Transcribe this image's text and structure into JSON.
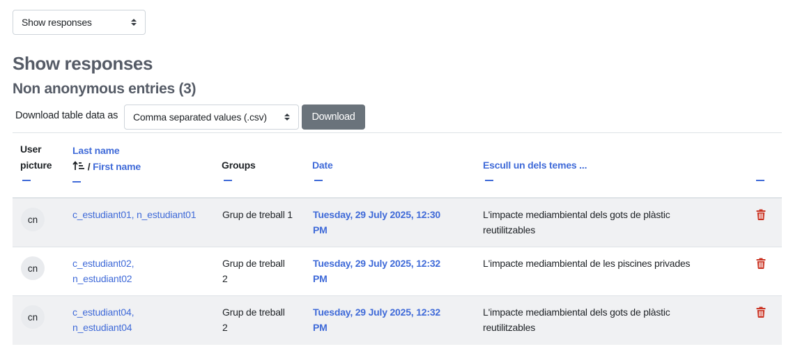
{
  "view_select": {
    "value": "Show responses"
  },
  "page_title": "Show responses",
  "section_title": "Non anonymous entries (3)",
  "download": {
    "label": "Download table data as",
    "format_value": "Comma separated values (.csv)",
    "button_label": "Download"
  },
  "table": {
    "headers": {
      "user_picture_line1": "User",
      "user_picture_line2": "picture",
      "last_name": "Last name",
      "separator": "/",
      "first_name": "First name",
      "groups": "Groups",
      "date": "Date",
      "question": "Escull un dels temes ..."
    },
    "rows": [
      {
        "initials": "cn",
        "name_line1": "c_estudiant01, n_estudiant01",
        "name_line2": "",
        "group_line1": "Grup de treball 1",
        "group_line2": "",
        "date_line1": "Tuesday, 29 July 2025, 12:30",
        "date_line2": "PM",
        "answer_line1": "L'impacte mediambiental dels gots de plàstic",
        "answer_line2": "reutilitzables"
      },
      {
        "initials": "cn",
        "name_line1": "c_estudiant02,",
        "name_line2": "n_estudiant02",
        "group_line1": "Grup de treball",
        "group_line2": "2",
        "date_line1": "Tuesday, 29 July 2025, 12:32",
        "date_line2": "PM",
        "answer_line1": "L'impacte mediambiental de les piscines privades",
        "answer_line2": ""
      },
      {
        "initials": "cn",
        "name_line1": "c_estudiant04,",
        "name_line2": "n_estudiant04",
        "group_line1": "Grup de treball",
        "group_line2": "2",
        "date_line1": "Tuesday, 29 July 2025, 12:32",
        "date_line2": "PM",
        "answer_line1": "L'impacte mediambiental dels gots de plàstic",
        "answer_line2": "reutilitzables"
      }
    ]
  },
  "colors": {
    "link": "#3f6ad8",
    "heading": "#555b66",
    "button": "#6a737b",
    "danger": "#ca3120",
    "stripe": "#f0f1f3"
  },
  "icons": {
    "sort": "sort-ascending-icon",
    "delete": "trash-icon",
    "collapse": "collapse-column-icon"
  }
}
